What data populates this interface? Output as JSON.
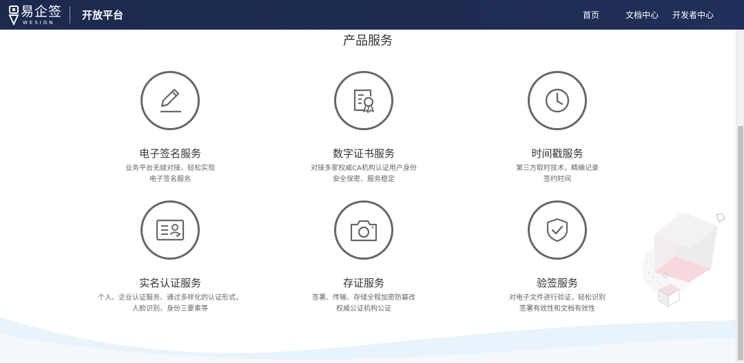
{
  "header": {
    "logo_text": "易企签",
    "logo_sub": "WESIGN",
    "platform_title": "开放平台",
    "nav": [
      "首页",
      "文档中心",
      "开发者中心"
    ]
  },
  "main": {
    "section_title": "产品服务",
    "services": [
      {
        "name": "电子签名服务",
        "desc1": "业务平台无缝对接，轻松实现",
        "desc2": "电子签名服务",
        "icon": "pen-icon"
      },
      {
        "name": "数字证书服务",
        "desc1": "对接多家权威CA机构认证用户身份",
        "desc2": "安全保密、服务稳定",
        "icon": "certificate-icon"
      },
      {
        "name": "时间戳服务",
        "desc1": "第三方取时技术，精确记录",
        "desc2": "签约时间",
        "icon": "clock-icon"
      },
      {
        "name": "实名认证服务",
        "desc1": "个人、企业认证服务、通过多样化的认证形式，",
        "desc2": "人脸识别、身份三要素等",
        "icon": "id-card-icon"
      },
      {
        "name": "存证服务",
        "desc1": "签署、传输、存储全程加密防篡改",
        "desc2": "权威公证机构公证",
        "icon": "camera-icon"
      },
      {
        "name": "验签服务",
        "desc1": "对电子文件进行验证，轻松识别",
        "desc2": "签署有效性和文档有效性",
        "icon": "shield-check-icon"
      }
    ]
  },
  "colors": {
    "header_bg": "#1e2c52",
    "icon_stroke": "#666666",
    "text_primary": "#333333"
  }
}
